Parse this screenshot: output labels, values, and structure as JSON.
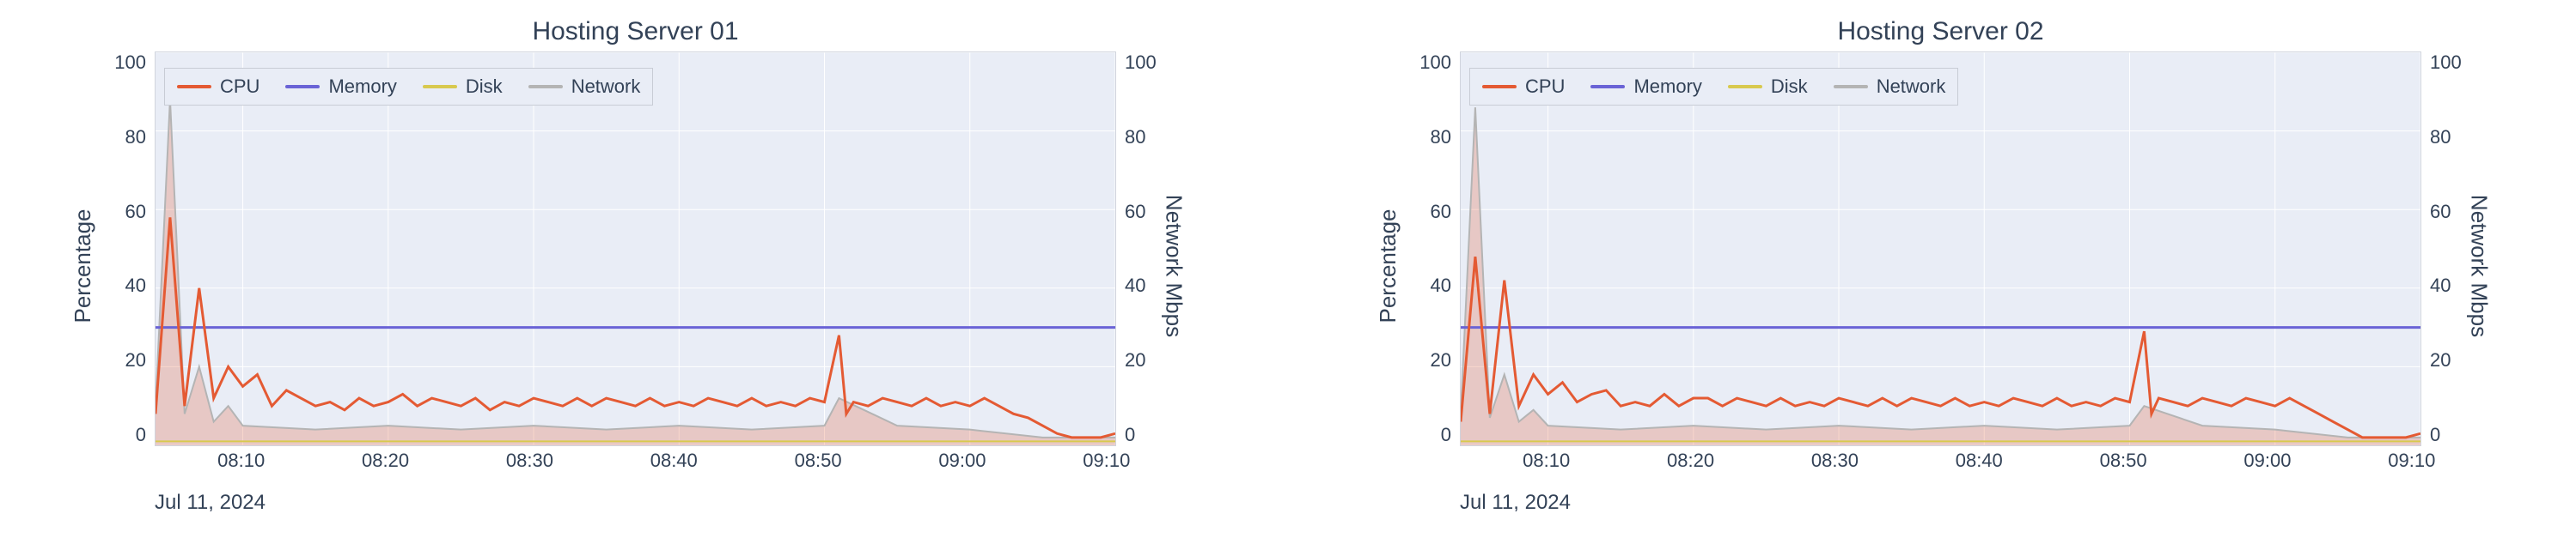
{
  "chart_data": [
    {
      "type": "line",
      "title": "Hosting Server 01",
      "xlabel": "",
      "ylabel_left": "Percentage",
      "ylabel_right": "Network Mbps",
      "ylim_left": [
        0,
        100
      ],
      "ylim_right": [
        0,
        100
      ],
      "date_label": "Jul 11, 2024",
      "x_ticks": [
        "08:10",
        "08:20",
        "08:30",
        "08:40",
        "08:50",
        "09:00",
        "09:10"
      ],
      "y_ticks_left": [
        "0",
        "20",
        "40",
        "60",
        "80",
        "100"
      ],
      "y_ticks_right": [
        "0",
        "20",
        "40",
        "60",
        "80",
        "100"
      ],
      "legend": [
        "CPU",
        "Memory",
        "Disk",
        "Network"
      ],
      "colors": {
        "CPU": "#e45a33",
        "Memory": "#6a63d6",
        "Disk": "#d8c94e",
        "Network": "#b4b4b4"
      },
      "series": [
        {
          "name": "CPU",
          "axis": "left",
          "x": [
            "08:04",
            "08:05",
            "08:06",
            "08:07",
            "08:08",
            "08:09",
            "08:10",
            "08:11",
            "08:12",
            "08:13",
            "08:14",
            "08:15",
            "08:16",
            "08:17",
            "08:18",
            "08:19",
            "08:20",
            "08:21",
            "08:22",
            "08:23",
            "08:24",
            "08:25",
            "08:26",
            "08:27",
            "08:28",
            "08:29",
            "08:30",
            "08:31",
            "08:32",
            "08:33",
            "08:34",
            "08:35",
            "08:36",
            "08:37",
            "08:38",
            "08:39",
            "08:40",
            "08:41",
            "08:42",
            "08:43",
            "08:44",
            "08:45",
            "08:46",
            "08:47",
            "08:48",
            "08:49",
            "08:50",
            "08:51",
            "08:51.5",
            "08:52",
            "08:53",
            "08:54",
            "08:55",
            "08:56",
            "08:57",
            "08:58",
            "08:59",
            "09:00",
            "09:01",
            "09:02",
            "09:03",
            "09:04",
            "09:05",
            "09:06",
            "09:07",
            "09:08",
            "09:09",
            "09:10"
          ],
          "values": [
            8,
            58,
            10,
            40,
            12,
            20,
            15,
            18,
            10,
            14,
            12,
            10,
            11,
            9,
            12,
            10,
            11,
            13,
            10,
            12,
            11,
            10,
            12,
            9,
            11,
            10,
            12,
            11,
            10,
            12,
            10,
            12,
            11,
            10,
            12,
            10,
            11,
            10,
            12,
            11,
            10,
            12,
            10,
            11,
            10,
            12,
            11,
            28,
            8,
            11,
            10,
            12,
            11,
            10,
            12,
            10,
            11,
            10,
            12,
            10,
            8,
            7,
            5,
            3,
            2,
            2,
            2,
            3
          ]
        },
        {
          "name": "Memory",
          "axis": "left",
          "x": [
            "08:04",
            "09:10"
          ],
          "values": [
            30,
            30
          ]
        },
        {
          "name": "Disk",
          "axis": "left",
          "x": [
            "08:04",
            "09:10"
          ],
          "values": [
            1,
            1
          ]
        },
        {
          "name": "Network",
          "axis": "right",
          "x": [
            "08:04",
            "08:05",
            "08:06",
            "08:07",
            "08:08",
            "08:09",
            "08:10",
            "08:15",
            "08:20",
            "08:25",
            "08:30",
            "08:35",
            "08:40",
            "08:45",
            "08:50",
            "08:51",
            "08:55",
            "09:00",
            "09:05",
            "09:10"
          ],
          "values": [
            10,
            88,
            8,
            20,
            6,
            10,
            5,
            4,
            5,
            4,
            5,
            4,
            5,
            4,
            5,
            12,
            5,
            4,
            2,
            2
          ]
        }
      ]
    },
    {
      "type": "line",
      "title": "Hosting Server 02",
      "xlabel": "",
      "ylabel_left": "Percentage",
      "ylabel_right": "Network Mbps",
      "ylim_left": [
        0,
        100
      ],
      "ylim_right": [
        0,
        100
      ],
      "date_label": "Jul 11, 2024",
      "x_ticks": [
        "08:10",
        "08:20",
        "08:30",
        "08:40",
        "08:50",
        "09:00",
        "09:10"
      ],
      "y_ticks_left": [
        "0",
        "20",
        "40",
        "60",
        "80",
        "100"
      ],
      "y_ticks_right": [
        "0",
        "20",
        "40",
        "60",
        "80",
        "100"
      ],
      "legend": [
        "CPU",
        "Memory",
        "Disk",
        "Network"
      ],
      "colors": {
        "CPU": "#e45a33",
        "Memory": "#6a63d6",
        "Disk": "#d8c94e",
        "Network": "#b4b4b4"
      },
      "series": [
        {
          "name": "CPU",
          "axis": "left",
          "x": [
            "08:04",
            "08:05",
            "08:06",
            "08:07",
            "08:08",
            "08:09",
            "08:10",
            "08:11",
            "08:12",
            "08:13",
            "08:14",
            "08:15",
            "08:16",
            "08:17",
            "08:18",
            "08:19",
            "08:20",
            "08:21",
            "08:22",
            "08:23",
            "08:24",
            "08:25",
            "08:26",
            "08:27",
            "08:28",
            "08:29",
            "08:30",
            "08:31",
            "08:32",
            "08:33",
            "08:34",
            "08:35",
            "08:36",
            "08:37",
            "08:38",
            "08:39",
            "08:40",
            "08:41",
            "08:42",
            "08:43",
            "08:44",
            "08:45",
            "08:46",
            "08:47",
            "08:48",
            "08:49",
            "08:50",
            "08:51",
            "08:51.5",
            "08:52",
            "08:53",
            "08:54",
            "08:55",
            "08:56",
            "08:57",
            "08:58",
            "08:59",
            "09:00",
            "09:01",
            "09:02",
            "09:03",
            "09:04",
            "09:05",
            "09:06",
            "09:07",
            "09:08",
            "09:09",
            "09:10"
          ],
          "values": [
            6,
            48,
            8,
            42,
            10,
            18,
            13,
            16,
            11,
            13,
            14,
            10,
            11,
            10,
            13,
            10,
            12,
            12,
            10,
            12,
            11,
            10,
            12,
            10,
            11,
            10,
            12,
            11,
            10,
            12,
            10,
            12,
            11,
            10,
            12,
            10,
            11,
            10,
            12,
            11,
            10,
            12,
            10,
            11,
            10,
            12,
            11,
            29,
            8,
            12,
            11,
            10,
            12,
            11,
            10,
            12,
            11,
            10,
            12,
            10,
            8,
            6,
            4,
            2,
            2,
            2,
            2,
            3
          ]
        },
        {
          "name": "Memory",
          "axis": "left",
          "x": [
            "08:04",
            "09:10"
          ],
          "values": [
            30,
            30
          ]
        },
        {
          "name": "Disk",
          "axis": "left",
          "x": [
            "08:04",
            "09:10"
          ],
          "values": [
            1,
            1
          ]
        },
        {
          "name": "Network",
          "axis": "right",
          "x": [
            "08:04",
            "08:05",
            "08:06",
            "08:07",
            "08:08",
            "08:09",
            "08:10",
            "08:15",
            "08:20",
            "08:25",
            "08:30",
            "08:35",
            "08:40",
            "08:45",
            "08:50",
            "08:51",
            "08:55",
            "09:00",
            "09:05",
            "09:10"
          ],
          "values": [
            8,
            86,
            7,
            18,
            6,
            9,
            5,
            4,
            5,
            4,
            5,
            4,
            5,
            4,
            5,
            10,
            5,
            4,
            2,
            2
          ]
        }
      ]
    }
  ]
}
